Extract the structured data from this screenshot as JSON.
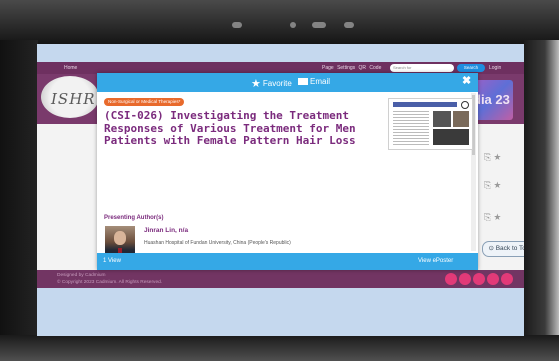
{
  "site": {
    "nav": {
      "home": "Home",
      "links": "Page Settings QR Code",
      "search_placeholder": "Search for",
      "search_button": "Search",
      "login": "Login"
    },
    "logo_text": "ISHR",
    "event_logo_text": "dia 23",
    "side_rows": [
      "⎘ ★",
      "⎘ ★",
      "⎘ ★"
    ],
    "back_to_top": "⊙ Back to Top",
    "footer": {
      "designed_by": "Designed by Cadmium",
      "copyright": "© Copyright 2023 Cadmium. All Rights Reserved."
    }
  },
  "modal": {
    "header": {
      "favorite_icon": "★",
      "favorite_label": "Favorite",
      "email_label": "Email",
      "close": "✖"
    },
    "category_tag": "Non-Surgical or Medical Therapies*",
    "title": "(CSI-026) Investigating the Treatment Responses of Various Treatment for Men Patients with Female Pattern Hair Loss",
    "presenting_label": "Presenting Author(s)",
    "author": {
      "name": "Jinran Lin, n/a",
      "affiliation": "Huashan Hospital of Fundan University, China (People's Republic)"
    },
    "footer": {
      "views": "1 View",
      "view_eposter": "View ePoster"
    }
  },
  "colors": {
    "modal_blue": "#35a8e6",
    "title_purple": "#7b2b7d",
    "tag_orange": "#e86a2c",
    "site_purple": "#6e3060"
  },
  "icons": [
    "star-icon",
    "mail-icon",
    "close-icon",
    "document-icon",
    "social-icons"
  ]
}
